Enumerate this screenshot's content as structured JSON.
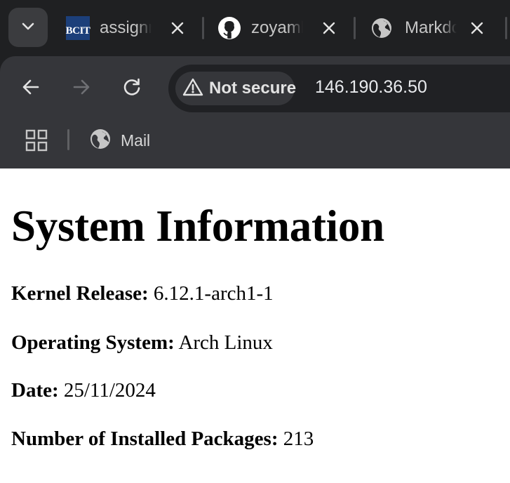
{
  "tabs": [
    {
      "title": "assignment",
      "icon": "bcit-logo-icon",
      "favicon_text": "BCIT"
    },
    {
      "title": "zoyambulov",
      "icon": "github-icon"
    },
    {
      "title": "Markdown",
      "icon": "globe-icon"
    }
  ],
  "toolbar": {
    "security_label": "Not secure",
    "url": "146.190.36.50"
  },
  "bookmarks": [
    {
      "label": "Mail",
      "icon": "globe-icon"
    }
  ],
  "page": {
    "title": "System Information",
    "fields": [
      {
        "label": "Kernel Release:",
        "value": "6.12.1-arch1-1"
      },
      {
        "label": "Operating System:",
        "value": "Arch Linux"
      },
      {
        "label": "Date:",
        "value": "25/11/2024"
      },
      {
        "label": "Number of Installed Packages:",
        "value": "213"
      }
    ]
  },
  "colors": {
    "tabstrip_bg": "#1f2022",
    "toolbar_bg": "#35363a",
    "omnibox_bg": "#202124",
    "page_bg": "#ffffff"
  }
}
